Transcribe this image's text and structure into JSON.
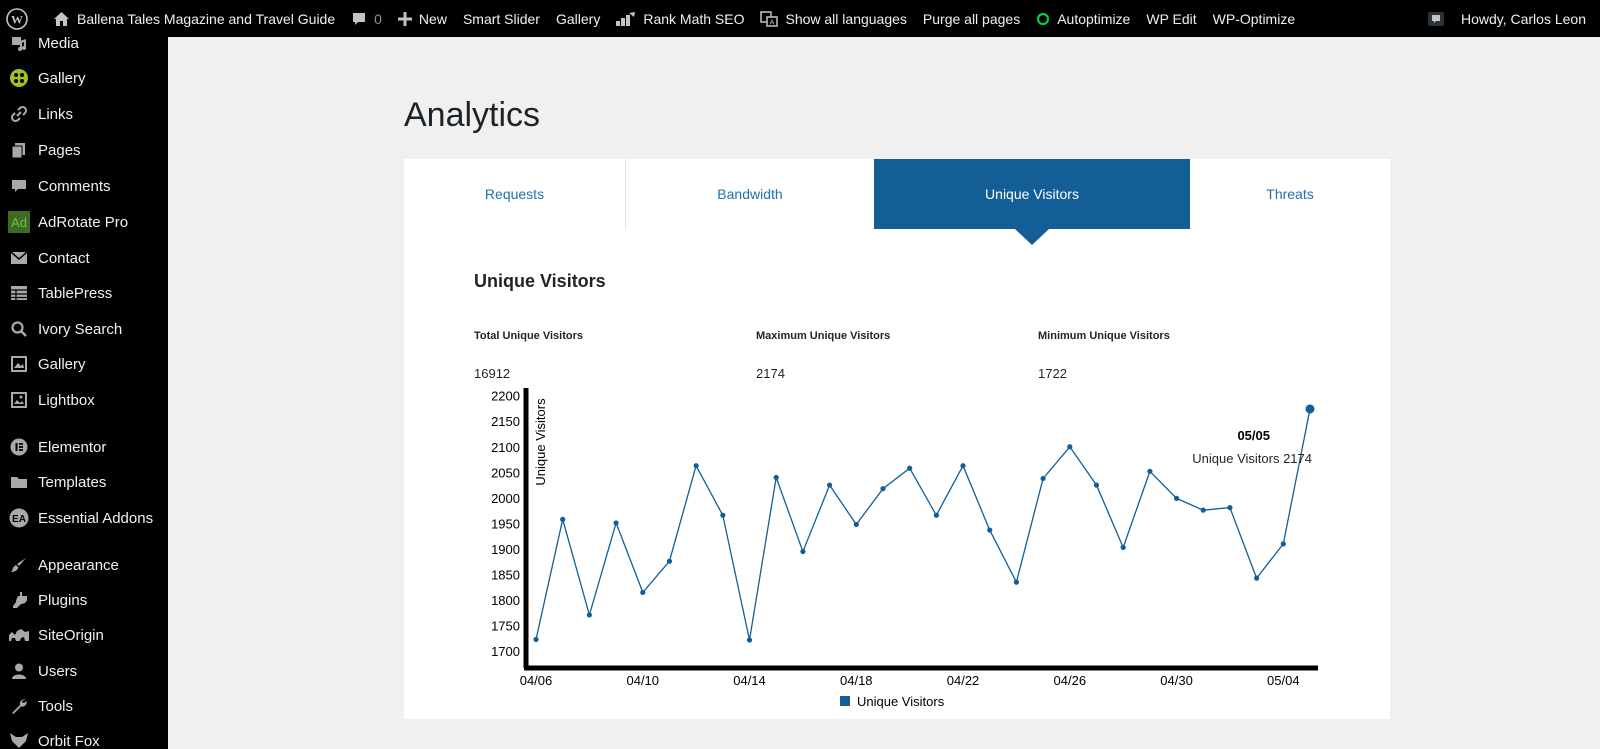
{
  "adminbar": {
    "site_name": "Ballena Tales Magazine and Travel Guide",
    "comments_count": "0",
    "new_label": "New",
    "smart_slider": "Smart Slider",
    "gallery": "Gallery",
    "rank_math": "Rank Math SEO",
    "show_languages": "Show all languages",
    "purge": "Purge all pages",
    "autoptimize": "Autoptimize",
    "wp_edit": "WP Edit",
    "wp_optimize": "WP-Optimize",
    "howdy": "Howdy, Carlos Leon"
  },
  "sidebar": {
    "items": [
      {
        "label": "Media",
        "icon": "media-icon"
      },
      {
        "label": "Gallery",
        "icon": "gallery-plugin-icon"
      },
      {
        "label": "Links",
        "icon": "link-icon"
      },
      {
        "label": "Pages",
        "icon": "pages-icon"
      },
      {
        "label": "Comments",
        "icon": "comment-icon"
      },
      {
        "label": "AdRotate Pro",
        "icon": "adrotate-icon"
      },
      {
        "label": "Contact",
        "icon": "mail-icon"
      },
      {
        "label": "TablePress",
        "icon": "table-icon"
      },
      {
        "label": "Ivory Search",
        "icon": "search-icon"
      },
      {
        "label": "Gallery",
        "icon": "image-gallery-icon"
      },
      {
        "label": "Lightbox",
        "icon": "lightbox-icon"
      },
      {
        "label": "Elementor",
        "icon": "elementor-icon"
      },
      {
        "label": "Templates",
        "icon": "folder-icon"
      },
      {
        "label": "Essential Addons",
        "icon": "essential-addons-icon"
      },
      {
        "label": "Appearance",
        "icon": "brush-icon"
      },
      {
        "label": "Plugins",
        "icon": "plugin-icon"
      },
      {
        "label": "SiteOrigin",
        "icon": "siteorigin-icon"
      },
      {
        "label": "Users",
        "icon": "user-icon"
      },
      {
        "label": "Tools",
        "icon": "wrench-icon"
      },
      {
        "label": "Orbit Fox",
        "icon": "fox-icon"
      }
    ]
  },
  "page": {
    "title": "Analytics",
    "tabs": [
      "Requests",
      "Bandwidth",
      "Unique Visitors",
      "Threats"
    ],
    "active_tab": "Unique Visitors",
    "section_title": "Unique Visitors",
    "stats": [
      {
        "label": "Total Unique Visitors",
        "value": "16912"
      },
      {
        "label": "Maximum Unique Visitors",
        "value": "2174"
      },
      {
        "label": "Minimum Unique Visitors",
        "value": "1722"
      }
    ]
  },
  "colors": {
    "accent": "#135e96",
    "link": "#2271b1",
    "series": "#135e96",
    "adminbar_bg": "#000000"
  },
  "chart_data": {
    "type": "line",
    "ylabel": "Unique Visitors",
    "xlabel": "",
    "ylim": [
      1675,
      2215
    ],
    "yticks": [
      1700,
      1750,
      1800,
      1850,
      1900,
      1950,
      2000,
      2050,
      2100,
      2150,
      2200
    ],
    "x_tick_labels": [
      "04/06",
      "04/10",
      "04/14",
      "04/18",
      "04/22",
      "04/26",
      "04/30",
      "05/04"
    ],
    "legend": "Unique Visitors",
    "legend_position": "bottom-center",
    "tooltip": {
      "date": "05/05",
      "label": "Unique Visitors",
      "value": "2174"
    },
    "series": [
      {
        "name": "Unique Visitors",
        "x": [
          "04/06",
          "04/07",
          "04/08",
          "04/09",
          "04/10",
          "04/11",
          "04/12",
          "04/13",
          "04/14",
          "04/15",
          "04/16",
          "04/17",
          "04/18",
          "04/19",
          "04/20",
          "04/21",
          "04/22",
          "04/23",
          "04/24",
          "04/25",
          "04/26",
          "04/27",
          "04/28",
          "04/29",
          "04/30",
          "05/01",
          "05/02",
          "05/03",
          "05/04",
          "05/05"
        ],
        "values": [
          1723,
          1958,
          1771,
          1951,
          1815,
          1876,
          2063,
          1966,
          1722,
          2040,
          1895,
          2025,
          1948,
          2018,
          2058,
          1966,
          2063,
          1937,
          1835,
          2038,
          2100,
          2025,
          1903,
          2052,
          1999,
          1976,
          1981,
          1843,
          1910,
          2174
        ]
      }
    ]
  }
}
